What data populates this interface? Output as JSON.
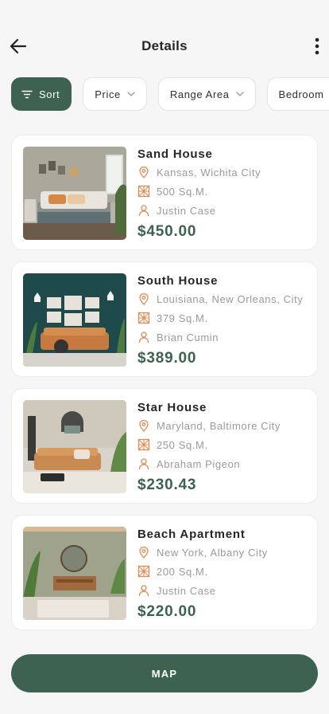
{
  "header": {
    "title": "Details"
  },
  "filters": [
    {
      "label": "Sort"
    },
    {
      "label": "Price"
    },
    {
      "label": "Range Area"
    },
    {
      "label": "Bedroom"
    }
  ],
  "listings": [
    {
      "name": "Sand House",
      "location": "Kansas, Wichita City",
      "area": "500 Sq.M.",
      "agent": "Justin Case",
      "price": "$450.00"
    },
    {
      "name": "South House",
      "location": "Louisiana, New Orleans, City",
      "area": "379 Sq.M.",
      "agent": "Brian Cumin",
      "price": "$389.00"
    },
    {
      "name": "Star House",
      "location": "Maryland, Baltimore City",
      "area": "250 Sq.M.",
      "agent": "Abraham Pigeon",
      "price": "$230.43"
    },
    {
      "name": "Beach Apartment",
      "location": "New York, Albany City",
      "area": "200 Sq.M.",
      "agent": "Justin Case",
      "price": "$220.00"
    }
  ],
  "map_button": {
    "label": "MAP"
  },
  "icons": {
    "back": "arrow-left-icon",
    "more": "vertical-dots-icon",
    "sort": "sort-lines-icon",
    "dropdown": "chevron-down-icon",
    "location": "map-pin-icon",
    "area": "area-grid-icon",
    "agent": "person-icon"
  },
  "colors": {
    "accent": "#3d6350",
    "icon": "#e08a55",
    "muted_text": "#9a9a9a",
    "background": "#f6f6f6"
  }
}
